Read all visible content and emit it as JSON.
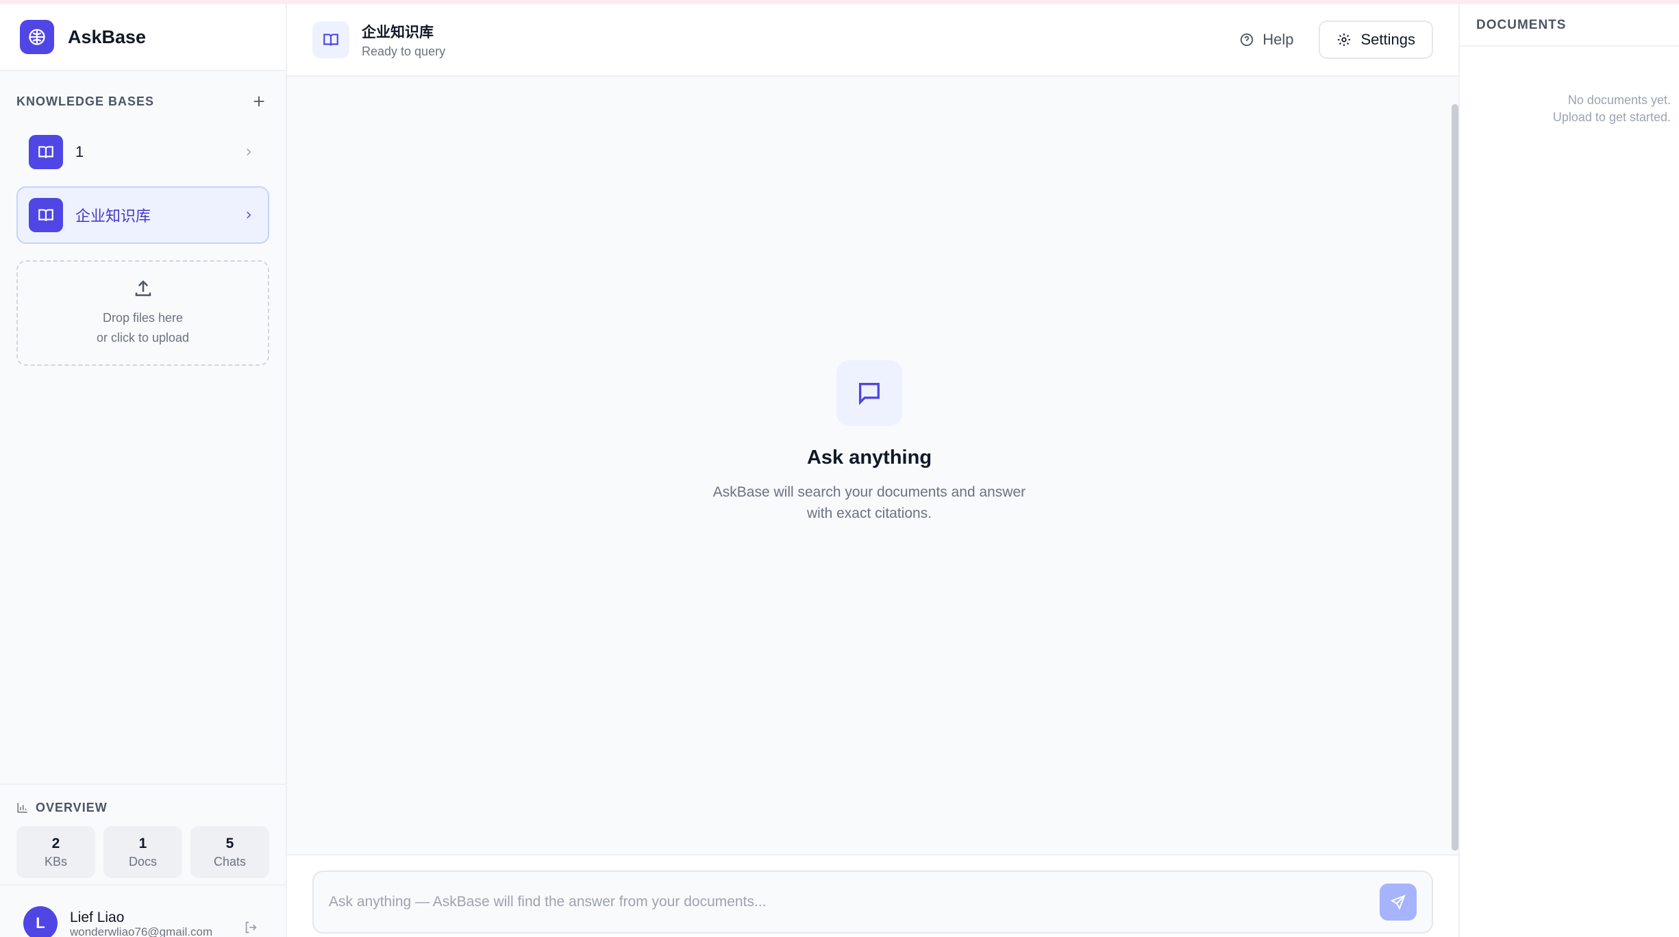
{
  "app": {
    "name": "AskBase"
  },
  "sidebar": {
    "kb_section_label": "KNOWLEDGE BASES",
    "knowledge_bases": [
      {
        "label": "1",
        "active": false
      },
      {
        "label": "企业知识库",
        "active": true
      }
    ],
    "dropzone": {
      "line1": "Drop files here",
      "line2": "or click to upload"
    },
    "overview": {
      "label": "OVERVIEW",
      "stats": [
        {
          "value": "2",
          "label": "KBs"
        },
        {
          "value": "1",
          "label": "Docs"
        },
        {
          "value": "5",
          "label": "Chats"
        }
      ]
    },
    "user": {
      "initial": "L",
      "name": "Lief Liao",
      "email": "wonderwliao76@gmail.com"
    }
  },
  "header": {
    "title": "企业知识库",
    "subtitle": "Ready to query",
    "help_label": "Help",
    "settings_label": "Settings"
  },
  "chat": {
    "empty_title": "Ask anything",
    "empty_desc_line1": "AskBase will search your documents and answer",
    "empty_desc_line2": "with exact citations.",
    "input_placeholder": "Ask anything — AskBase will find the answer from your documents..."
  },
  "documents": {
    "label": "DOCUMENTS",
    "empty_line1": "No documents yet.",
    "empty_line2": "Upload to get started."
  },
  "colors": {
    "accent": "#4f46e5",
    "accent_light": "#eef2ff",
    "send_disabled": "#a5b4fc"
  }
}
